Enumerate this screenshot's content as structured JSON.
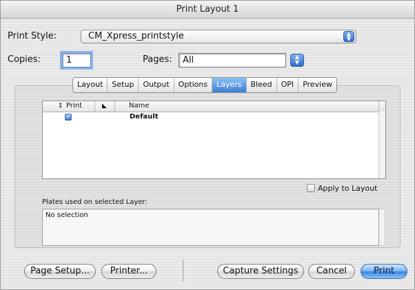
{
  "window": {
    "title": "Print Layout 1"
  },
  "print_style": {
    "label": "Print Style:",
    "value": "CM_Xpress_printstyle"
  },
  "copies": {
    "label": "Copies:",
    "value": "1"
  },
  "pages": {
    "label": "Pages:",
    "value": "All"
  },
  "tabs": [
    {
      "label": "Layout",
      "selected": false
    },
    {
      "label": "Setup",
      "selected": false
    },
    {
      "label": "Output",
      "selected": false
    },
    {
      "label": "Options",
      "selected": false
    },
    {
      "label": "Layers",
      "selected": true
    },
    {
      "label": "Bleed",
      "selected": false
    },
    {
      "label": "OPI",
      "selected": false
    },
    {
      "label": "Preview",
      "selected": false
    }
  ],
  "layers_table": {
    "columns": {
      "sort": "↕",
      "print": "Print",
      "name": "Name"
    },
    "rows": [
      {
        "print": true,
        "name": "Default"
      }
    ]
  },
  "apply_to_layout": {
    "label": "Apply to Layout",
    "checked": false
  },
  "plates": {
    "label": "Plates used on selected Layer:",
    "value": "No selection"
  },
  "buttons": {
    "page_setup": "Page Setup...",
    "printer": "Printer...",
    "capture_settings": "Capture Settings",
    "cancel": "Cancel",
    "print": "Print"
  },
  "colors": {
    "accent": "#3d7fd6"
  }
}
